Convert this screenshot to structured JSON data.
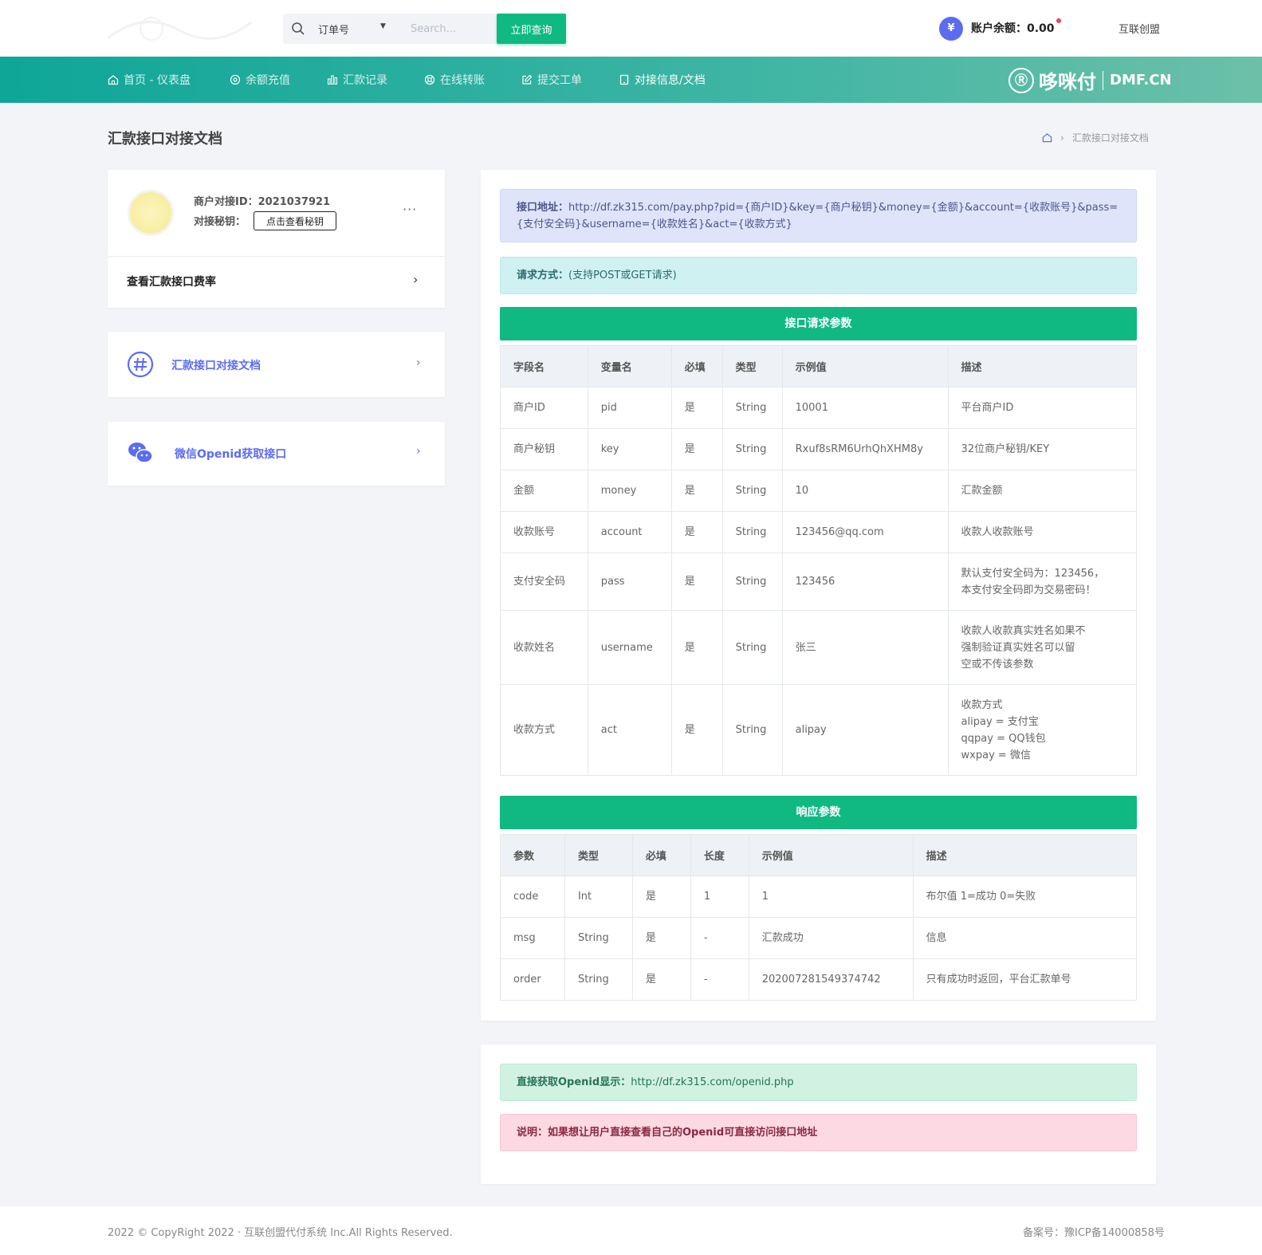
{
  "search": {
    "select_value": "订单号",
    "placeholder": "Search...",
    "button_label": "立即查询"
  },
  "header": {
    "balance_icon": "¥",
    "balance_text": "账户余额：0.00",
    "user_name": "互联创盟"
  },
  "nav": {
    "items": [
      {
        "label": "首页 - 仪表盘",
        "icon": "home-icon"
      },
      {
        "label": "余额充值",
        "icon": "circle-icon"
      },
      {
        "label": "汇款记录",
        "icon": "bar-chart-icon"
      },
      {
        "label": "在线转账",
        "icon": "lifebuoy-icon"
      },
      {
        "label": "提交工单",
        "icon": "edit-icon"
      },
      {
        "label": "对接信息/文档",
        "icon": "tablet-icon"
      }
    ],
    "active_index": 5
  },
  "brand": {
    "cn": "哆咪付",
    "en": "DMF.CN"
  },
  "page": {
    "title": "汇款接口对接文档",
    "breadcrumb": "汇款接口对接文档"
  },
  "profile": {
    "merchant_id": "商户对接ID：2021037921",
    "secret_label": "对接秘钥：",
    "secret_button": "点击查看秘钥",
    "more": "···",
    "rate_link": "查看汇款接口费率",
    "rate_arrow": "›"
  },
  "links": [
    {
      "label": "汇款接口对接文档",
      "icon": "hash-icon",
      "arrow": "›"
    },
    {
      "label": "微信Openid获取接口",
      "icon": "wechat-icon",
      "arrow": "›"
    }
  ],
  "doc": {
    "api_label": "接口地址：",
    "api_url": "http://df.zk315.com/pay.php?pid={商户ID}&key={商户秘钥}&money={金额}&account={收款账号}&pass={支付安全码}&username={收款姓名}&act={收款方式}",
    "method_label": "请求方式：",
    "method_value": "(支持POST或GET请求)",
    "request_title": "接口请求参数",
    "request_headers": [
      "字段名",
      "变量名",
      "必填",
      "类型",
      "示例值",
      "描述"
    ],
    "request_rows": [
      [
        "商户ID",
        "pid",
        "是",
        "String",
        "10001",
        "平台商户ID"
      ],
      [
        "商户秘钥",
        "key",
        "是",
        "String",
        "Rxuf8sRM6UrhQhXHM8y",
        "32位商户秘钥/KEY"
      ],
      [
        "金额",
        "money",
        "是",
        "String",
        "10",
        "汇款金额"
      ],
      [
        "收款账号",
        "account",
        "是",
        "String",
        "123456@qq.com",
        "收款人收款账号"
      ],
      [
        "支付安全码",
        "pass",
        "是",
        "String",
        "123456",
        "默认支付安全码为：123456，\n本支付安全码即为交易密码！"
      ],
      [
        "收款姓名",
        "username",
        "是",
        "String",
        "张三",
        "收款人收款真实姓名如果不\n强制验证真实姓名可以留\n空或不传该参数"
      ],
      [
        "收款方式",
        "act",
        "是",
        "String",
        "alipay",
        "收款方式\nalipay = 支付宝\nqqpay = QQ钱包\nwxpay = 微信"
      ]
    ],
    "response_title": "响应参数",
    "response_headers": [
      "参数",
      "类型",
      "必填",
      "长度",
      "示例值",
      "描述"
    ],
    "response_rows": [
      [
        "code",
        "Int",
        "是",
        "1",
        "1",
        "布尔值 1=成功 0=失败"
      ],
      [
        "msg",
        "String",
        "是",
        "-",
        "汇款成功",
        "信息"
      ],
      [
        "order",
        "String",
        "是",
        "-",
        "202007281549374742",
        "只有成功时返回，平台汇款单号"
      ]
    ]
  },
  "openid": {
    "label": "直接获取Openid显示：",
    "url": "http://df.zk315.com/openid.php",
    "note": "说明：如果想让用户直接查看自己的Openid可直接访问接口地址"
  },
  "footer": {
    "copyright": "2022 © CopyRight 2022 · 互联创盟代付系统 Inc.All Rights Reserved.",
    "icp": "备案号：豫ICP备14000858号"
  },
  "colors": {
    "accent_green": "#10b981",
    "nav_teal": "#0ea698",
    "link_blue": "#5b6cf2"
  }
}
